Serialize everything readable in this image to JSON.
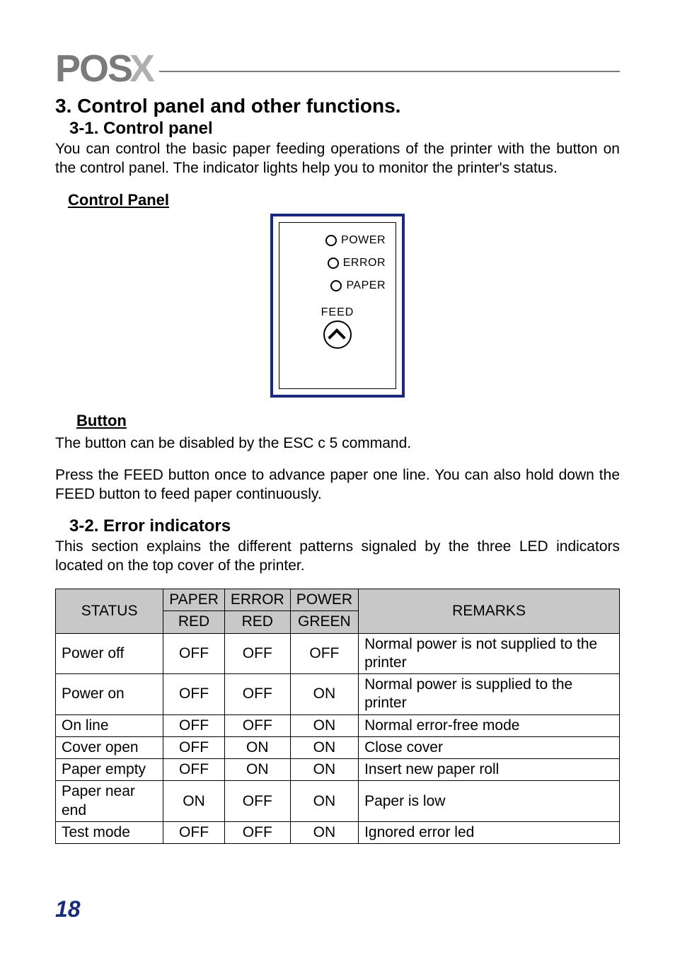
{
  "logo": {
    "left": "POS",
    "right": "X"
  },
  "section_title": "3. Control panel and other functions.",
  "sub_3_1": "3-1. Control panel",
  "intro_3_1": "You can control the basic paper feeding operations of the printer with the button on the control panel. The indicator lights help you to monitor the printer's status.",
  "heading_control_panel": "Control Panel",
  "panel": {
    "power_label": "POWER",
    "error_label": "ERROR",
    "paper_label": "PAPER",
    "feed_label": "FEED"
  },
  "heading_button": "Button",
  "button_line1": "The button can be disabled by the ESC c 5 command.",
  "button_line2": "Press the FEED button once to advance paper one line. You can also hold down the FEED button to feed paper continuously.",
  "sub_3_2": "3-2. Error indicators",
  "intro_3_2": "This section explains the different patterns signaled by the three LED indicators located on the top cover of the printer.",
  "table": {
    "headers": {
      "status": "STATUS",
      "paper": "PAPER",
      "paper_color": "RED",
      "error": "ERROR",
      "error_color": "RED",
      "power": "POWER",
      "power_color": "GREEN",
      "remarks": "REMARKS"
    },
    "rows": [
      {
        "status": "Power off",
        "paper": "OFF",
        "error": "OFF",
        "power": "OFF",
        "remarks": "Normal power is not supplied to the printer"
      },
      {
        "status": "Power on",
        "paper": "OFF",
        "error": "OFF",
        "power": "ON",
        "remarks": "Normal power is supplied to the printer"
      },
      {
        "status": "On line",
        "paper": "OFF",
        "error": "OFF",
        "power": "ON",
        "remarks": "Normal error-free mode"
      },
      {
        "status": "Cover open",
        "paper": "OFF",
        "error": "ON",
        "power": "ON",
        "remarks": "Close cover"
      },
      {
        "status": "Paper empty",
        "paper": "OFF",
        "error": "ON",
        "power": "ON",
        "remarks": "Insert new paper roll"
      },
      {
        "status": "Paper near end",
        "paper": "ON",
        "error": "OFF",
        "power": "ON",
        "remarks": "Paper is low"
      },
      {
        "status": "Test mode",
        "paper": "OFF",
        "error": "OFF",
        "power": "ON",
        "remarks": "Ignored error led"
      }
    ]
  },
  "page_number": "18"
}
